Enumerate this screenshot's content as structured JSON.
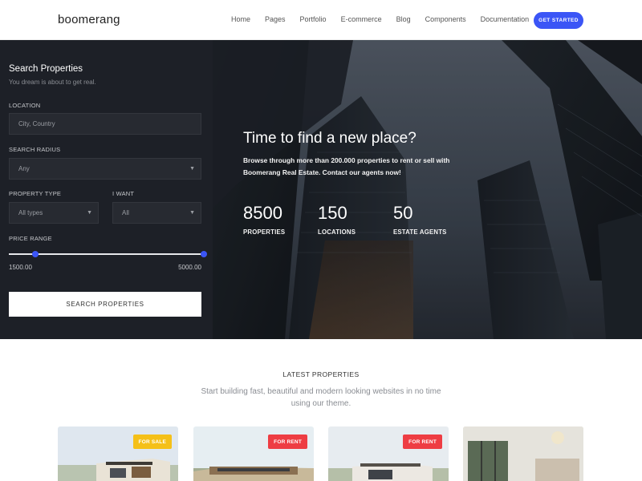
{
  "header": {
    "logo": "boomerang",
    "nav": [
      "Home",
      "Pages",
      "Portfolio",
      "E-commerce",
      "Blog",
      "Components",
      "Documentation"
    ],
    "cta_label": "GET STARTED"
  },
  "search": {
    "title": "Search Properties",
    "subtitle": "You dream is about to get real.",
    "location_label": "LOCATION",
    "location_placeholder": "City, Country",
    "radius_label": "SEARCH RADIUS",
    "radius_value": "Any",
    "type_label": "PROPERTY TYPE",
    "type_value": "All types",
    "want_label": "I WANT",
    "want_value": "All",
    "price_label": "PRICE RANGE",
    "price_min": "1500.00",
    "price_max": "5000.00",
    "button_label": "SEARCH PROPERTIES"
  },
  "hero": {
    "title": "Time to find a new place?",
    "description": "Browse through more than 200.000 properties to rent or sell with Boomerang Real Estate. Contact our agents now!",
    "stats": [
      {
        "value": "8500",
        "label": "PROPERTIES"
      },
      {
        "value": "150",
        "label": "LOCATIONS"
      },
      {
        "value": "50",
        "label": "ESTATE AGENTS"
      }
    ]
  },
  "latest": {
    "title": "LATEST PROPERTIES",
    "subtitle": "Start building fast, beautiful and modern looking websites in no time using our theme.",
    "cards": [
      {
        "badge": "FOR SALE",
        "badge_color": "#f5c018"
      },
      {
        "badge": "FOR RENT",
        "badge_color": "#ee3d43"
      },
      {
        "badge": "FOR RENT",
        "badge_color": "#ee3d43"
      }
    ]
  },
  "colors": {
    "accent": "#3b55f6",
    "panel": "#1d2027",
    "sale": "#f5c018",
    "rent": "#ee3d43"
  }
}
